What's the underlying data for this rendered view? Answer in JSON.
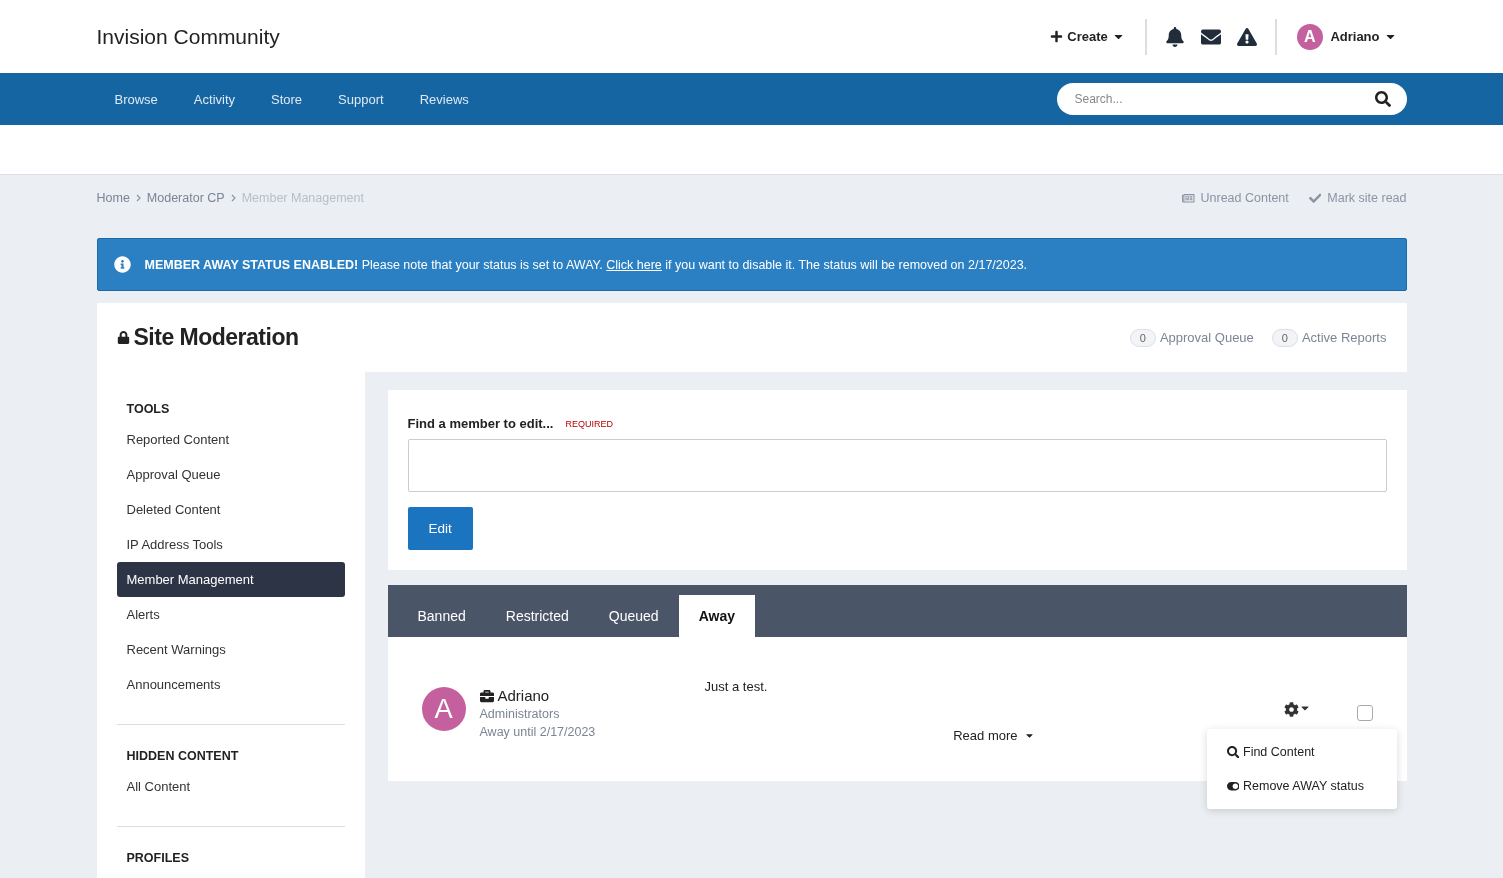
{
  "header": {
    "site_title": "Invision Community",
    "create": "Create",
    "user": {
      "initial": "A",
      "name": "Adriano"
    }
  },
  "nav": {
    "items": [
      {
        "label": "Browse",
        "selected": false
      },
      {
        "label": "Activity",
        "selected": false
      },
      {
        "label": "Store",
        "selected": false
      },
      {
        "label": "Support",
        "selected": false
      },
      {
        "label": "Reviews",
        "selected": false
      }
    ],
    "search": {
      "placeholder": "Search..."
    }
  },
  "breadcrumb": [
    {
      "label": "Home",
      "current": false
    },
    {
      "label": "Moderator CP",
      "current": false
    },
    {
      "label": "Member Management",
      "current": true
    }
  ],
  "page_actions": [
    {
      "kind": "unread",
      "label": "Unread Content"
    },
    {
      "kind": "mark",
      "label": "Mark site read"
    }
  ],
  "alert": {
    "text": "**MEMBER AWAY STATUS ENABLED!** Please note that your status is set to AWAY.",
    "link": "Click here",
    "text_after": "if you want to disable it. The status will be removed on 2/17/2023."
  },
  "moderation": {
    "title": "Site Moderation",
    "counters": [
      {
        "count": "0",
        "label": "Approval Queue"
      },
      {
        "count": "0",
        "label": "Active Reports"
      }
    ]
  },
  "sidebar": [
    {
      "heading": "TOOLS",
      "items": [
        {
          "label": "Reported Content",
          "selected": false
        },
        {
          "label": "Approval Queue",
          "selected": false
        },
        {
          "label": "Deleted Content",
          "selected": false
        },
        {
          "label": "IP Address Tools",
          "selected": false
        },
        {
          "label": "Member Management",
          "selected": true
        },
        {
          "label": "Alerts",
          "selected": false
        },
        {
          "label": "Recent Warnings",
          "selected": false
        },
        {
          "label": "Announcements",
          "selected": false
        }
      ]
    },
    {
      "heading": "HIDDEN CONTENT",
      "items": [
        {
          "label": "All Content",
          "selected": false
        }
      ]
    },
    {
      "heading": "PROFILES"
    }
  ],
  "find_form": {
    "label": "Find a member to edit...",
    "required": "REQUIRED",
    "button": "Edit"
  },
  "tabs": [
    {
      "label": "Banned",
      "selected": false
    },
    {
      "label": "Restricted",
      "selected": false
    },
    {
      "label": "Queued",
      "selected": false
    },
    {
      "label": "Away",
      "selected": true
    }
  ],
  "members": [
    {
      "initial": "A",
      "name": "Adriano",
      "group": "Administrators",
      "away": "Away until 2/17/2023",
      "message": "Just a test.",
      "read_more": "Read more",
      "checked": false,
      "menu": [
        {
          "kind": "search",
          "label": "Find Content"
        },
        {
          "kind": "toggle",
          "label": "Remove AWAY status"
        }
      ]
    }
  ]
}
